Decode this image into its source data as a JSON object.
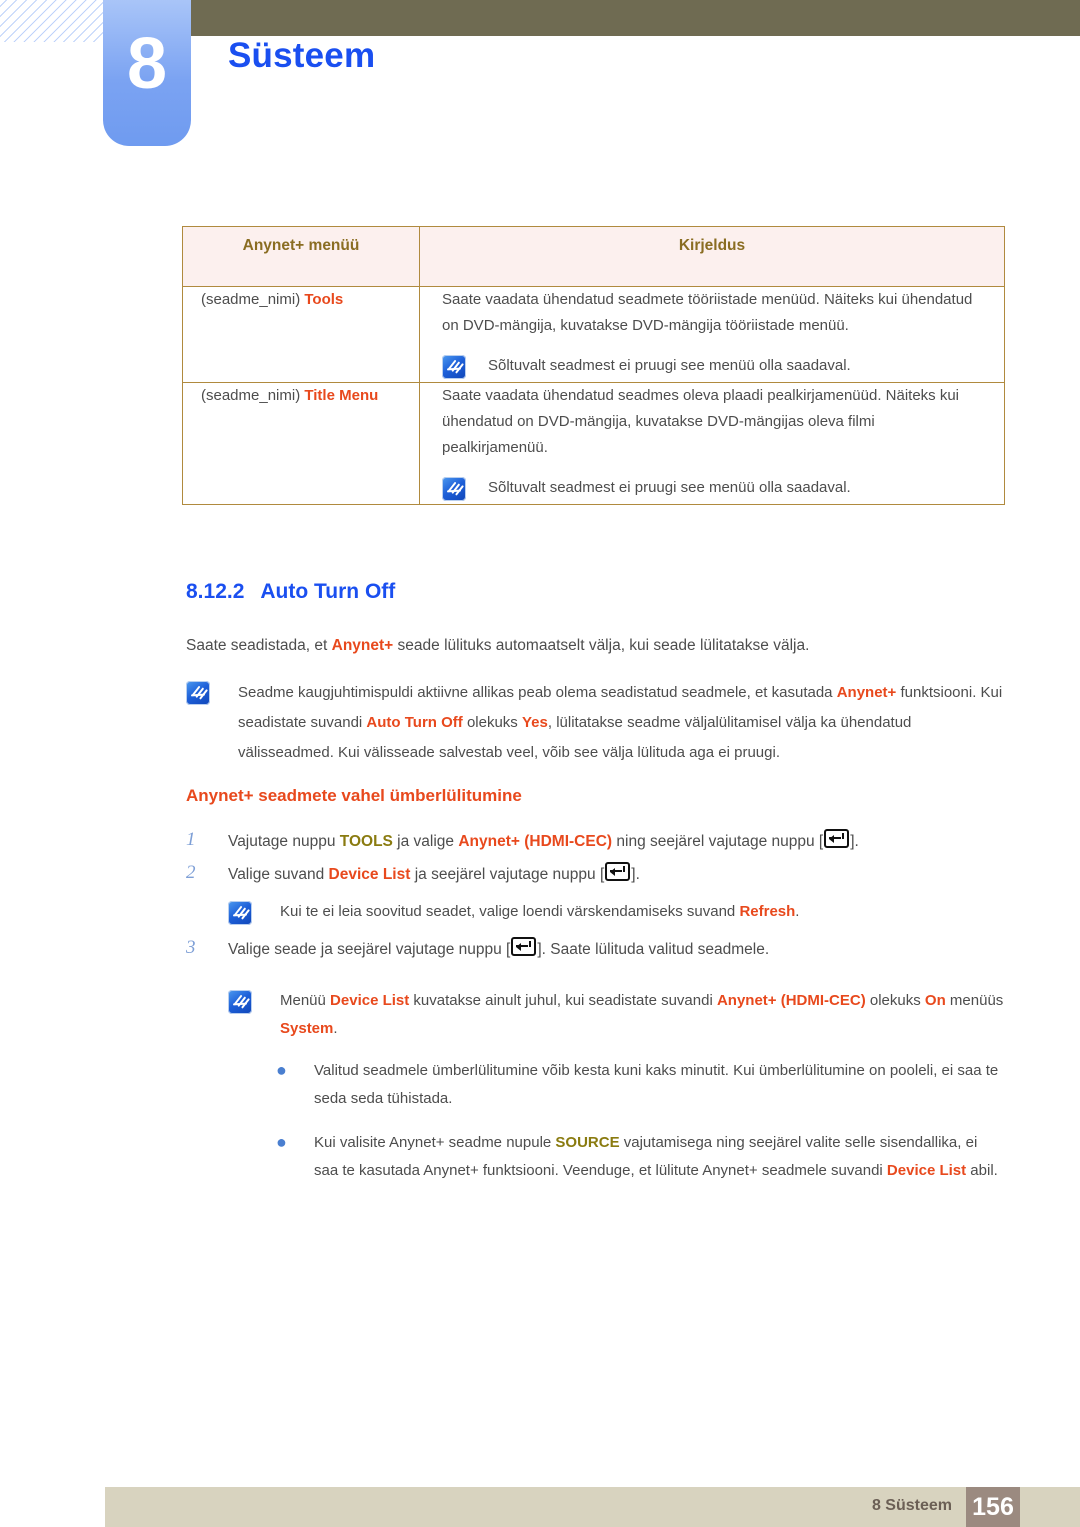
{
  "chapter": {
    "number": "8",
    "title": "Süsteem"
  },
  "table": {
    "headers": [
      "Anynet+ menüü",
      "Kirjeldus"
    ],
    "rows": [
      {
        "menu_prefix": "(seadme_nimi) ",
        "menu_term": "Tools",
        "description": "Saate vaadata ühendatud seadmete tööriistade menüüd. Näiteks kui ühendatud on DVD-mängija, kuvatakse DVD-mängija tööriistade menüü.",
        "note": "Sõltuvalt seadmest ei pruugi see menüü olla saadaval."
      },
      {
        "menu_prefix": "(seadme_nimi) ",
        "menu_term": "Title Menu",
        "description": "Saate vaadata ühendatud seadmes oleva plaadi pealkirjamenüüd. Näiteks kui ühendatud on DVD-mängija, kuvatakse DVD-mängijas oleva filmi pealkirjamenüü.",
        "note": "Sõltuvalt seadmest ei pruugi see menüü olla saadaval."
      }
    ]
  },
  "section": {
    "number": "8.12.2",
    "title": "Auto Turn Off",
    "intro_1": "Saate seadistada, et ",
    "intro_term": "Anynet+",
    "intro_2": " seade lülituks automaatselt välja, kui seade lülitatakse välja."
  },
  "note_main": {
    "t1": "Seadme kaugjuhtimispuldi aktiivne allikas peab olema seadistatud seadmele, et kasutada ",
    "t2": "Anynet+",
    "t3": " funktsiooni. Kui seadistate suvandi ",
    "t4": "Auto Turn Off",
    "t5": " olekuks ",
    "t6": "Yes",
    "t7": ", lülitatakse seadme väljalülitamisel välja ka ühendatud välisseadmed. Kui välisseade salvestab veel, võib see välja lülituda aga ei pruugi."
  },
  "subsection": {
    "title": "Anynet+ seadmete vahel ümberlülitumine"
  },
  "steps": [
    {
      "num": "1",
      "t1": "Vajutage nuppu ",
      "t2": "TOOLS",
      "t3": " ja valige ",
      "t4": "Anynet+ (HDMI-CEC)",
      "t5": " ning seejärel vajutage nuppu [",
      "t6": "]."
    },
    {
      "num": "2",
      "t1": "Valige suvand ",
      "t2": "Device List",
      "t3": " ja seejärel vajutage nuppu [",
      "t4": "]."
    },
    {
      "num": "3",
      "t1": "Valige seade ja seejärel vajutage nuppu [",
      "t2": "]. Saate lülituda valitud seadmele."
    }
  ],
  "note_refresh": {
    "t1": "Kui te ei leia soovitud seadet, valige loendi värskendamiseks suvand ",
    "t2": "Refresh",
    "t3": "."
  },
  "note_devicelist": {
    "t1": "Menüü ",
    "t2": "Device List",
    "t3": " kuvatakse ainult juhul, kui seadistate suvandi ",
    "t4": "Anynet+ (HDMI-CEC)",
    "t5": " olekuks ",
    "t6": "On",
    "t7": " menüüs ",
    "t8": "System",
    "t9": "."
  },
  "bullets": [
    {
      "t1": "Valitud seadmele ümberlülitumine võib kesta kuni kaks minutit. Kui ümberlülitumine on pooleli, ei saa te seda seda tühistada."
    },
    {
      "t1": "Kui valisite Anynet+ seadme nupule ",
      "t2": "SOURCE",
      "t3": " vajutamisega ning seejärel valite selle sisendallika, ei saa te kasutada Anynet+ funktsiooni. Veenduge, et lülitute Anynet+ seadmele suvandi ",
      "t4": "Device List",
      "t5": " abil."
    }
  ],
  "footer": {
    "label": "8 Süsteem",
    "page": "156"
  },
  "colors": {
    "accent_blue": "#1a4ff0",
    "accent_orange": "#e8491d",
    "accent_olive": "#8a7b10",
    "header_bar": "#6f6b52",
    "footer_bar": "#d8d3bf",
    "page_box": "#9b8a80"
  },
  "icons": {
    "note": "note-icon",
    "enter": "enter-key-icon",
    "bullet": "bullet-dot-icon"
  }
}
